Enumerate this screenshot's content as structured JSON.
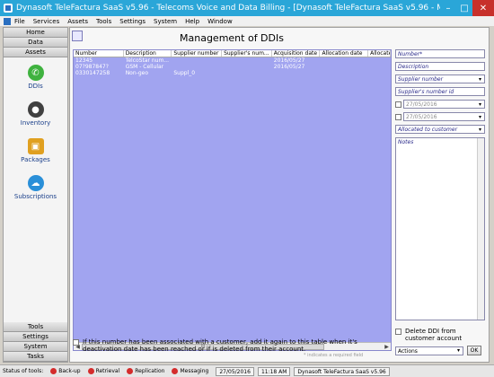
{
  "window": {
    "title": "Dynasoft TeleFactura SaaS v5.96 - Telecoms Voice and Data Billing - [Dynasoft TeleFactura SaaS v5.96 - Management of D...",
    "minimize": "–",
    "maximize": "□",
    "close": "✕"
  },
  "menu": [
    "File",
    "Services",
    "Assets",
    "Tools",
    "Settings",
    "System",
    "Help",
    "Window"
  ],
  "nav": {
    "top": [
      "Home",
      "Data",
      "Assets"
    ],
    "assets": [
      {
        "label": "DDIs",
        "icon": "phone-icon",
        "glyph": "✆"
      },
      {
        "label": "Inventory",
        "icon": "inventory-icon",
        "glyph": "●"
      },
      {
        "label": "Packages",
        "icon": "packages-icon",
        "glyph": "▣"
      },
      {
        "label": "Subscriptions",
        "icon": "subscriptions-icon",
        "glyph": "☁"
      }
    ],
    "bottom": [
      "Tools",
      "Settings",
      "System",
      "Tasks"
    ]
  },
  "page": {
    "title": "Management of DDIs",
    "required_note": "* indicates a required field",
    "deactivation_text": "If this number has been associated with a customer, add it again to this table when it's deactivation date has been reached or if is deleted from their account."
  },
  "grid": {
    "columns": [
      "Number",
      "Description",
      "Supplier number",
      "Supplier's num...",
      "Acquisition date",
      "Allocation date",
      "Allocate"
    ],
    "rows": [
      [
        "12345",
        "TelcoStar num...",
        "",
        "",
        "2016/05/27",
        "",
        ""
      ],
      [
        "07?987847?",
        "GSM - Cellular",
        "",
        "",
        "2016/05/27",
        "",
        ""
      ],
      [
        "0330147258",
        "Non-geo",
        "Suppl_0",
        "",
        "",
        "",
        ""
      ]
    ],
    "scroll_thumb": "III"
  },
  "form": {
    "number_placeholder": "Number*",
    "description_placeholder": "Description",
    "supplier_number_placeholder": "Supplier number",
    "suppliers_number_id_placeholder": "Supplier's number id",
    "date1": "27/05/2016",
    "date2": "27/05/2016",
    "allocated_placeholder": "Allocated to customer",
    "notes_placeholder": "Notes",
    "delete_label": "Delete DDI from customer account",
    "actions_value": "Actions",
    "ok_label": "OK",
    "dropdown_glyph": "▾"
  },
  "status": {
    "status_of_tools": "Status of tools:",
    "items": [
      "Back-up",
      "Retrieval",
      "Replication",
      "Messaging"
    ],
    "date": "27/05/2016",
    "time": "11:18 AM",
    "app": "Dynasoft TeleFactura SaaS v5.96"
  },
  "colors": {
    "titlebar": "#2aa6d8",
    "grid_bg": "#a1a4f0",
    "status_led": "#d42c2c"
  }
}
